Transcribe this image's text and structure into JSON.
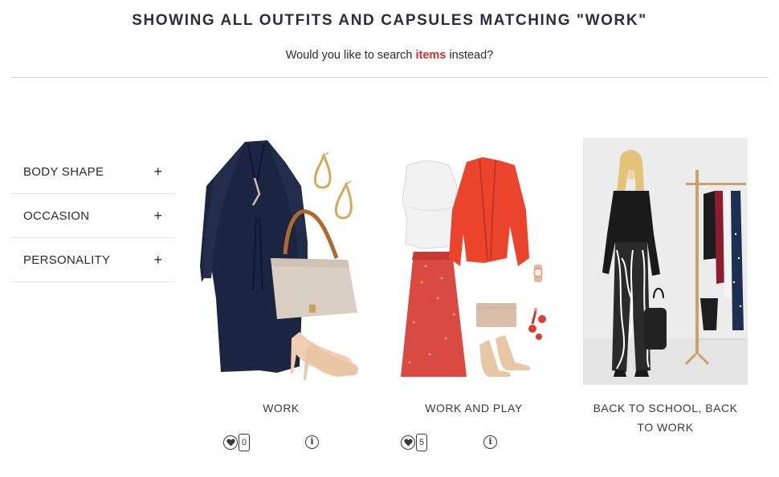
{
  "header": {
    "title": "SHOWING ALL OUTFITS AND CAPSULES MATCHING \"WORK\"",
    "subtitle_prefix": "Would you like to search ",
    "subtitle_link": "items",
    "subtitle_suffix": " instead?"
  },
  "filters": [
    {
      "label": "BODY SHAPE",
      "icon": "+"
    },
    {
      "label": "OCCASION",
      "icon": "+"
    },
    {
      "label": "PERSONALITY",
      "icon": "+"
    }
  ],
  "cards": [
    {
      "title": "WORK",
      "likes": "0",
      "info": "i"
    },
    {
      "title": "WORK AND PLAY",
      "likes": "5",
      "info": "i"
    },
    {
      "title": "BACK TO SCHOOL, BACK TO WORK"
    }
  ],
  "colors": {
    "accent": "#d0312d",
    "navy": "#1b2440",
    "red": "#e8412a"
  }
}
